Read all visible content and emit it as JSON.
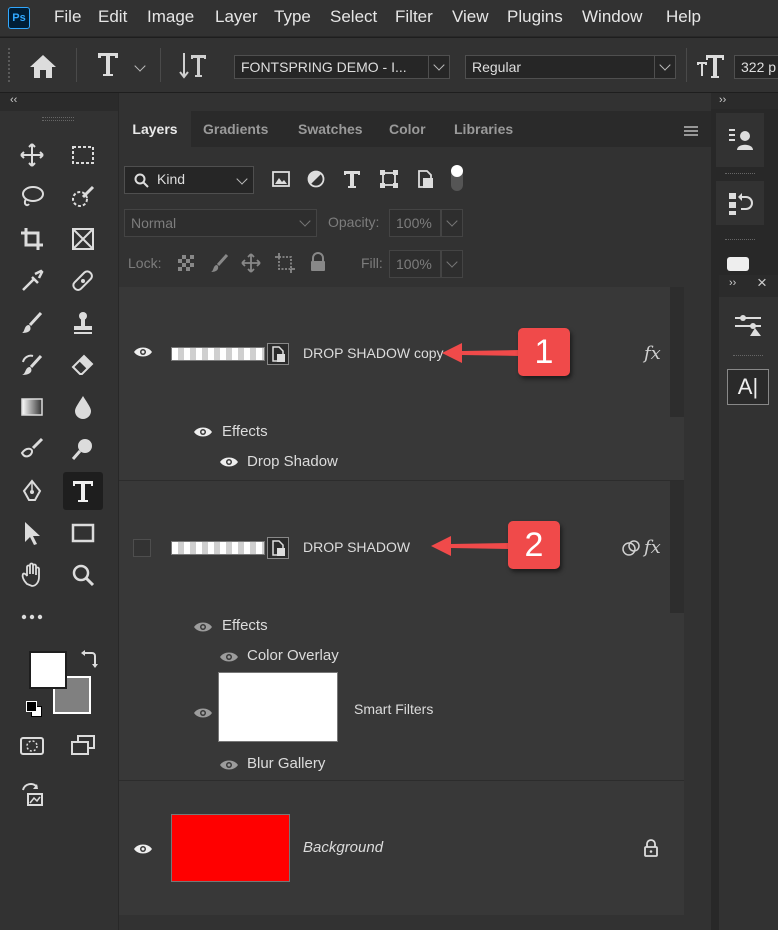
{
  "app": {
    "logo": "Ps"
  },
  "menu": [
    "File",
    "Edit",
    "Image",
    "Layer",
    "Type",
    "Select",
    "Filter",
    "View",
    "Plugins",
    "Window",
    "Help"
  ],
  "options_bar": {
    "font_family": "FONTSPRING DEMO - I...",
    "font_style": "Regular",
    "font_size": "322 p"
  },
  "panel": {
    "tabs": [
      "Layers",
      "Gradients",
      "Swatches",
      "Color",
      "Libraries"
    ],
    "active_tab": "Layers",
    "filter_kind": "Kind",
    "blend_mode": "Normal",
    "opacity_label": "Opacity:",
    "opacity_value": "100%",
    "lock_label": "Lock:",
    "fill_label": "Fill:",
    "fill_value": "100%",
    "layers": [
      {
        "name": "DROP SHADOW copy",
        "fx": "fx",
        "effects_label": "Effects",
        "effects": [
          "Drop Shadow"
        ],
        "visible": true
      },
      {
        "name": "DROP SHADOW",
        "fx": "fx",
        "effects_label": "Effects",
        "effects": [
          "Color Overlay"
        ],
        "smart_filters_label": "Smart Filters",
        "smart_filters": [
          "Blur Gallery"
        ],
        "visible": false
      },
      {
        "name": "Background",
        "locked": true,
        "fill_color": "#ff0000",
        "visible": true
      }
    ]
  },
  "annotations": {
    "badge1": "1",
    "badge2": "2",
    "color": "#f04a4a"
  },
  "colors": {
    "foreground": "#ffffff",
    "background": "#808080",
    "accent": "#31a8ff"
  }
}
